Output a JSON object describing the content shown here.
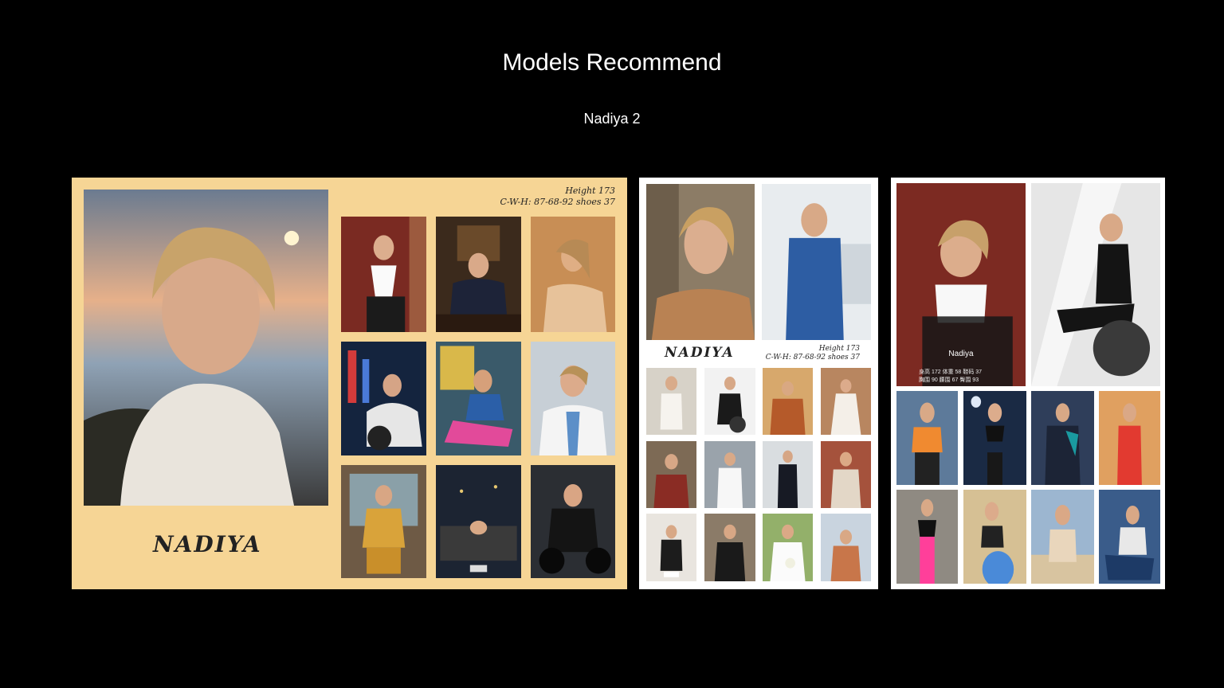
{
  "header": {
    "title": "Models Recommend",
    "subtitle": "Nadiya 2"
  },
  "card1": {
    "name": "NADIYA",
    "height_line": "Height 173",
    "measure_line": "C-W-H: 87-68-92 shoes 37"
  },
  "card2": {
    "name": "NADIYA",
    "height_line": "Height 173",
    "measure_line": "C-W-H: 87-68-92 shoes 37"
  },
  "card3": {
    "name": "Nadiya",
    "stats_line1": "身高 172  体重 58  鞋码 37",
    "stats_line2": "胸围 90  腰围 67  臀围 93"
  },
  "colors": {
    "background": "#000000",
    "card1_bg": "#f6d595",
    "card_white": "#ffffff",
    "text": "#ffffff"
  }
}
